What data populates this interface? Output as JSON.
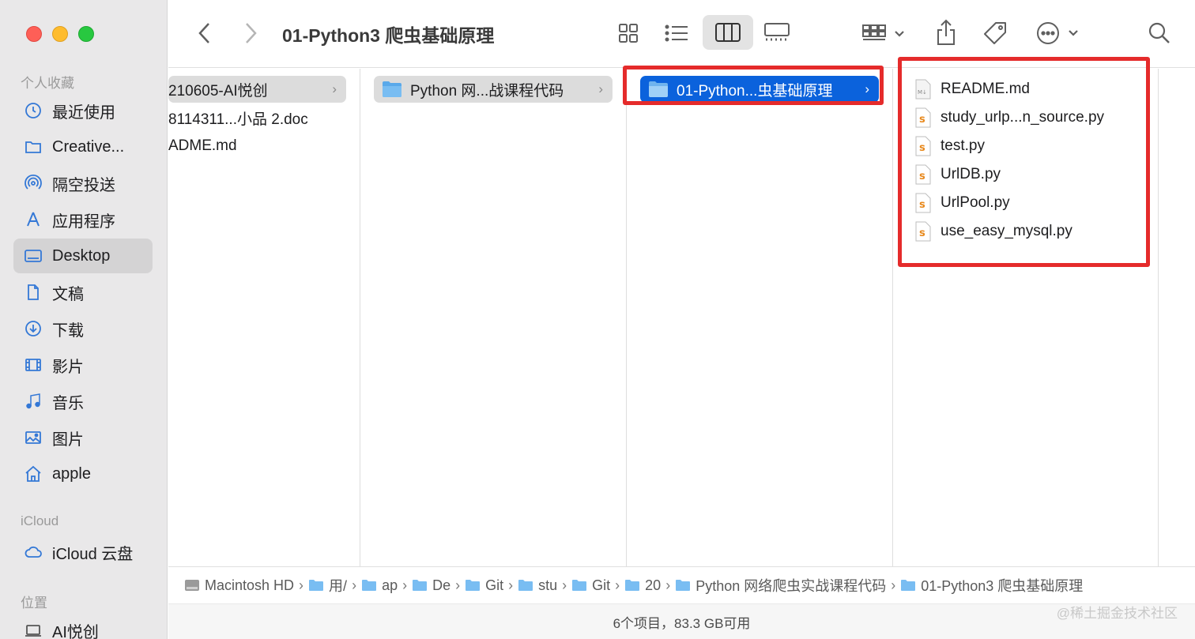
{
  "window": {
    "title": "01-Python3 爬虫基础原理"
  },
  "sidebar": {
    "favorites_label": "个人收藏",
    "items": [
      {
        "label": "最近使用",
        "icon": "clock-icon"
      },
      {
        "label": "Creative...",
        "icon": "folder-icon"
      },
      {
        "label": "隔空投送",
        "icon": "airdrop-icon"
      },
      {
        "label": "应用程序",
        "icon": "apps-icon"
      },
      {
        "label": "Desktop",
        "icon": "desktop-icon"
      },
      {
        "label": "文稿",
        "icon": "document-icon"
      },
      {
        "label": "下载",
        "icon": "download-icon"
      },
      {
        "label": "影片",
        "icon": "film-icon"
      },
      {
        "label": "音乐",
        "icon": "music-icon"
      },
      {
        "label": "图片",
        "icon": "photo-icon"
      },
      {
        "label": "apple",
        "icon": "home-icon"
      }
    ],
    "icloud_label": "iCloud",
    "icloud_items": [
      {
        "label": "iCloud 云盘",
        "icon": "cloud-icon"
      }
    ],
    "locations_label": "位置",
    "location_items": [
      {
        "label": "AI悦创",
        "icon": "laptop-icon"
      }
    ]
  },
  "columns": {
    "col1": [
      "210605-AI悦创",
      "8114311...小品 2.doc",
      "ADME.md"
    ],
    "col2": [
      "Python 网...战课程代码"
    ],
    "col3": [
      "01-Python...虫基础原理"
    ],
    "col4": [
      "README.md",
      "study_urlp...n_source.py",
      "test.py",
      "UrlDB.py",
      "UrlPool.py",
      "use_easy_mysql.py"
    ]
  },
  "pathbar": [
    "Macintosh HD",
    "用户",
    "apple",
    "Desktop",
    "GitHub",
    "stu",
    "Git",
    "20",
    "Python 网络爬虫实战课程代码",
    "01-Python3 爬虫基础原理"
  ],
  "pathbar_display": [
    "Macintosh HD",
    "用/",
    "ap",
    "De",
    "Git",
    "stu",
    "Git",
    "20",
    "Python 网络爬虫实战课程代码",
    "01-Python3 爬虫基础原理"
  ],
  "status": {
    "text": "6个项目，83.3 GB可用"
  },
  "watermark": {
    "text": "@稀土掘金技术社区"
  },
  "colors": {
    "accent": "#0b62dc",
    "highlight_box": "#e52b2b",
    "folder": "#5aa9ea"
  }
}
